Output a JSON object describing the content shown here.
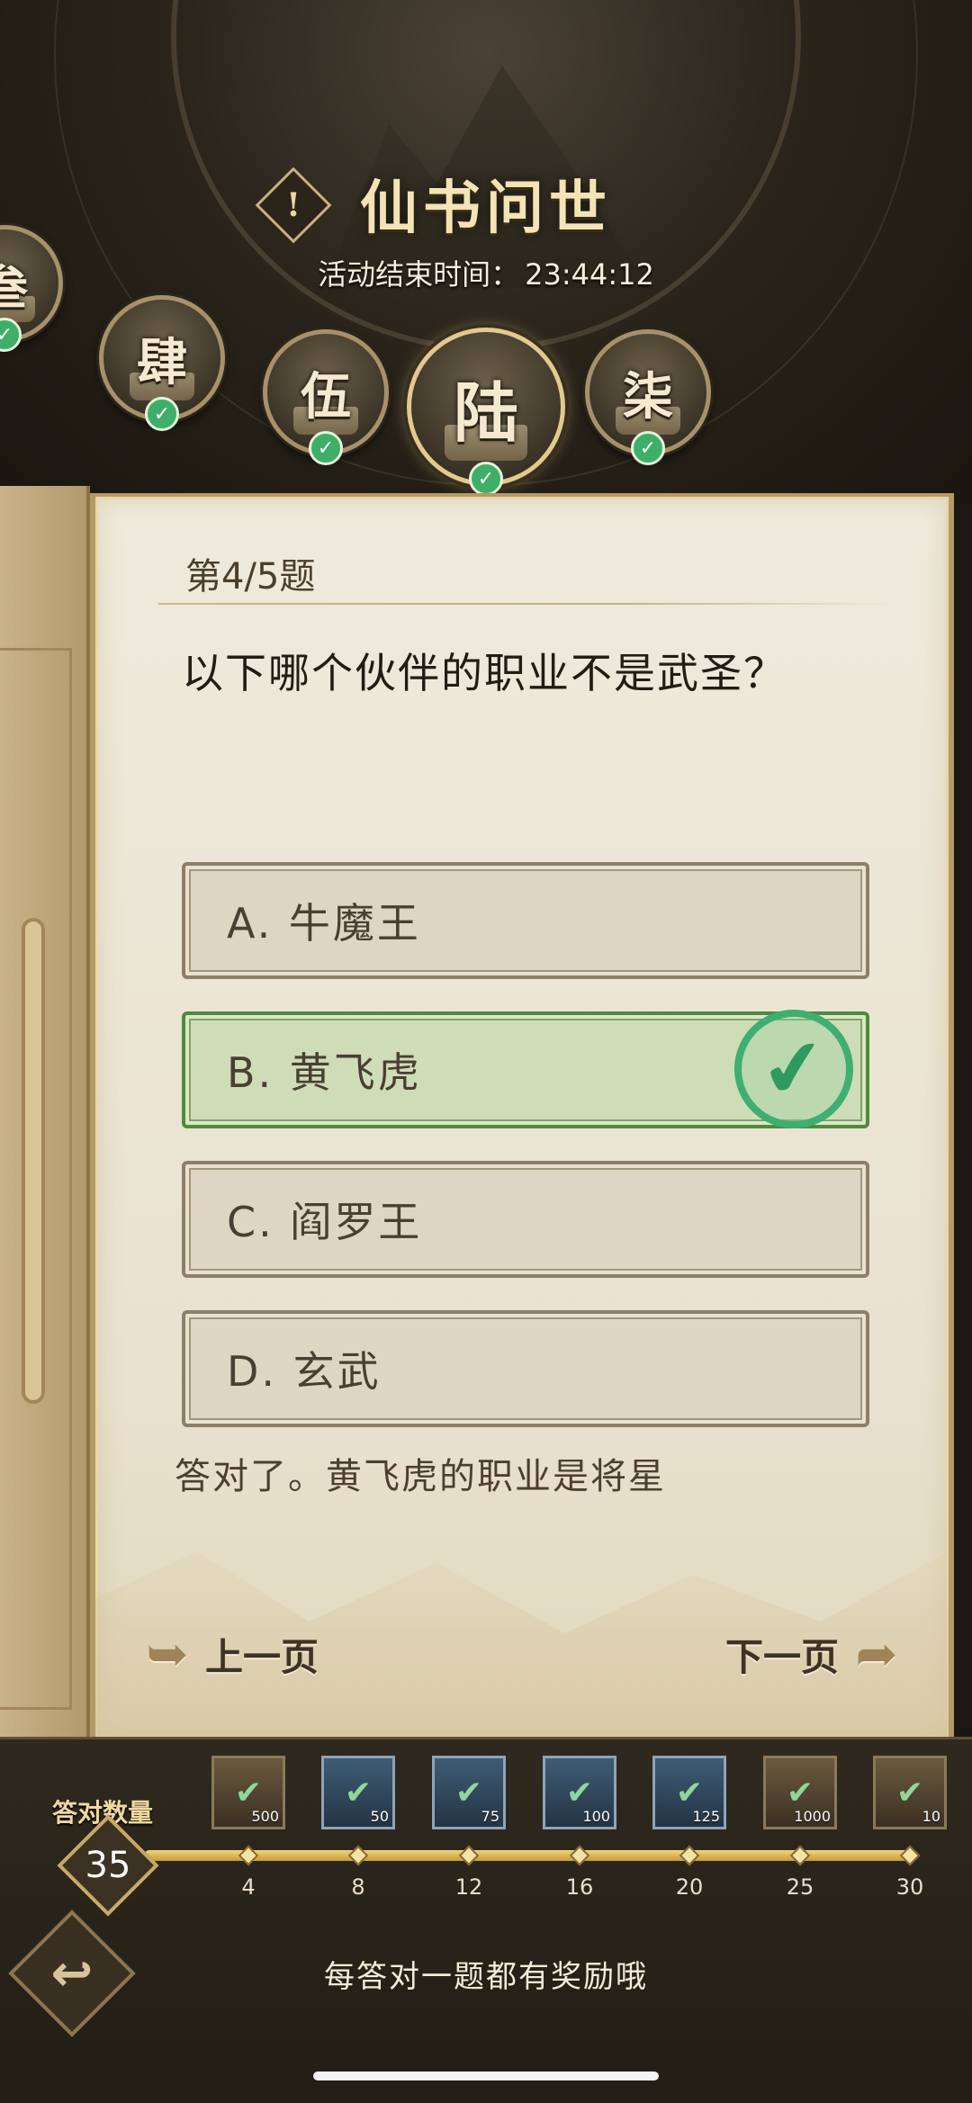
{
  "header": {
    "title": "仙书问世",
    "info_icon": "!",
    "end_time_label": "活动结束时间：",
    "end_time_value": "23:44:12"
  },
  "chapters": [
    {
      "label": "叁",
      "completed": true
    },
    {
      "label": "肆",
      "completed": true
    },
    {
      "label": "伍",
      "completed": true
    },
    {
      "label": "陆",
      "completed": true,
      "active": true
    },
    {
      "label": "柒",
      "completed": true
    }
  ],
  "quiz": {
    "question_number": "第4/5题",
    "question": "以下哪个伙伴的职业不是武圣？",
    "options": [
      {
        "label": "A. 牛魔王",
        "state": "normal"
      },
      {
        "label": "B. 黄飞虎",
        "state": "correct"
      },
      {
        "label": "C. 阎罗王",
        "state": "normal"
      },
      {
        "label": "D. 玄武",
        "state": "normal"
      }
    ],
    "feedback": "答对了。黄飞虎的职业是将星",
    "prev_label": "上一页",
    "next_label": "下一页"
  },
  "rewards": {
    "count_label": "答对数量",
    "count_value": "35",
    "milestones": [
      "4",
      "8",
      "12",
      "16",
      "20",
      "25",
      "30"
    ],
    "items": [
      {
        "amount": "500",
        "color": "brown",
        "icon": "reward-icon"
      },
      {
        "amount": "50",
        "color": "blue",
        "icon": "scroll-icon"
      },
      {
        "amount": "75",
        "color": "blue",
        "icon": "scroll-icon"
      },
      {
        "amount": "100",
        "color": "blue",
        "icon": "scroll-icon"
      },
      {
        "amount": "125",
        "color": "blue",
        "icon": "scroll-icon"
      },
      {
        "amount": "1000",
        "color": "brown",
        "icon": "reward-icon"
      },
      {
        "amount": "10",
        "color": "brown",
        "icon": "herb-icon"
      }
    ],
    "tip": "每答对一题都有奖励哦"
  },
  "colors": {
    "correct_green": "#3fae72",
    "gold": "#c9a867",
    "parchment": "#efeadc"
  }
}
